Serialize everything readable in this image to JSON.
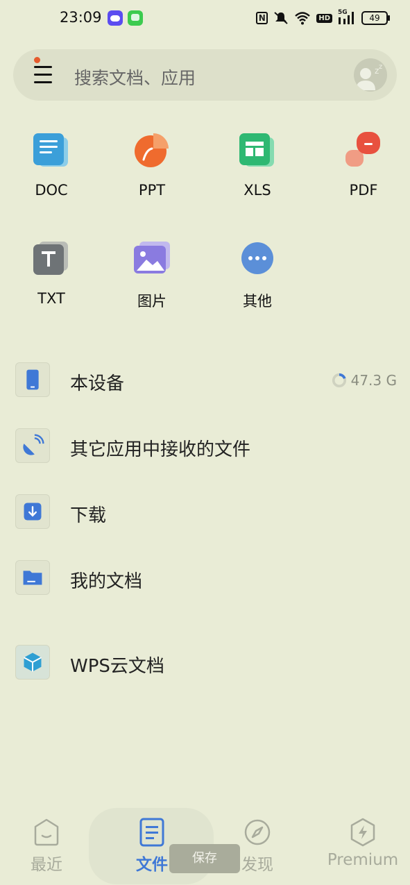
{
  "status_bar": {
    "time": "23:09",
    "hd_label": "HD",
    "network_label": "5G",
    "battery": "49"
  },
  "search": {
    "placeholder": "搜索文档、应用"
  },
  "file_types": [
    {
      "label": "DOC",
      "icon": "doc-icon",
      "color": "#3b9fd9"
    },
    {
      "label": "PPT",
      "icon": "ppt-icon",
      "color": "#ef6b2e"
    },
    {
      "label": "XLS",
      "icon": "xls-icon",
      "color": "#2eb872"
    },
    {
      "label": "PDF",
      "icon": "pdf-icon",
      "color": "#e8513f"
    },
    {
      "label": "TXT",
      "icon": "txt-icon",
      "color": "#6e7376"
    },
    {
      "label": "图片",
      "icon": "image-icon",
      "color": "#8a7be0"
    },
    {
      "label": "其他",
      "icon": "more-icon",
      "color": "#5b8fd8"
    }
  ],
  "locations": [
    {
      "label": "本设备",
      "icon": "phone-icon",
      "storage": "47.3 G"
    },
    {
      "label": "其它应用中接收的文件",
      "icon": "satellite-icon"
    },
    {
      "label": "下载",
      "icon": "download-icon"
    },
    {
      "label": "我的文档",
      "icon": "folder-icon"
    }
  ],
  "cloud": {
    "label": "WPS云文档",
    "icon": "cloud-cube-icon"
  },
  "bottom_nav": [
    {
      "label": "最近",
      "icon": "recent-icon",
      "active": false
    },
    {
      "label": "文件",
      "icon": "file-icon",
      "active": true
    },
    {
      "label": "发现",
      "icon": "compass-icon",
      "active": false
    },
    {
      "label": "Premium",
      "icon": "lightning-icon",
      "active": false
    }
  ],
  "toast": "保存",
  "colors": {
    "background": "#e9ecd6",
    "accent": "#3f78d6",
    "notification_dot": "#e55b2d"
  }
}
